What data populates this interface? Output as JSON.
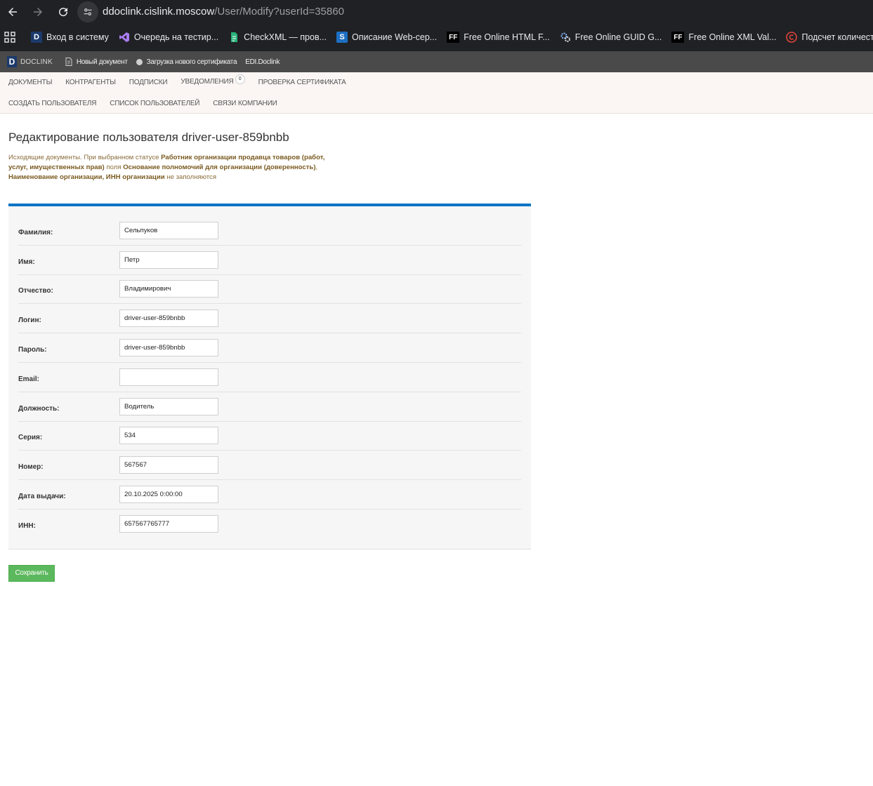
{
  "browser": {
    "url_host": "ddoclink.cislink.moscow",
    "url_path": "/User/Modify?userId=35860",
    "bookmarks": [
      {
        "label": "Вход в систему",
        "icon": "D"
      },
      {
        "label": "Очередь на тестир...",
        "icon": "VS"
      },
      {
        "label": "CheckXML — пров...",
        "icon": "doc"
      },
      {
        "label": "Описание Web-сер...",
        "icon": "S"
      },
      {
        "label": "Free Online HTML F...",
        "icon": "FF"
      },
      {
        "label": "Free Online GUID G...",
        "icon": "gear"
      },
      {
        "label": "Free Online XML Val...",
        "icon": "FF"
      },
      {
        "label": "Подсчет количеств...",
        "icon": "C"
      }
    ]
  },
  "sitebar": {
    "logo_letter": "D",
    "logo_text": "DOCLINK",
    "items": [
      {
        "label": "Новый документ"
      },
      {
        "label": "Загрузка нового сертификата"
      },
      {
        "label": "EDI.Doclink"
      }
    ]
  },
  "menu": {
    "row1": [
      "ДОКУМЕНТЫ",
      "КОНТРАГЕНТЫ",
      "ПОДПИСКИ",
      "УВЕДОМЛЕНИЯ",
      "ПРОВЕРКА СЕРТИФИКАТА"
    ],
    "notifications_count": "0",
    "row2": [
      "СОЗДАТЬ ПОЛЬЗОВАТЕЛЯ",
      "СПИСОК ПОЛЬЗОВАТЕЛЕЙ",
      "СВЯЗИ КОМПАНИИ"
    ]
  },
  "page": {
    "title": "Редактирование пользователя driver-user-859bnbb",
    "notice_1": "Исходящие документы. При выбранном статусе ",
    "notice_2": "Работник организации продавца товаров (работ, услуг, имущественных прав)",
    "notice_3": " поля ",
    "notice_4": "Основание полномочий для организации (доверенность)",
    "notice_5": ", ",
    "notice_6": "Наименование организации, ИНН организации",
    "notice_7": " не заполняются"
  },
  "form": {
    "fields": [
      {
        "label": "Фамилия:",
        "value": "Сельпуков"
      },
      {
        "label": "Имя:",
        "value": "Петр"
      },
      {
        "label": "Отчество:",
        "value": "Владимирович"
      },
      {
        "label": "Логин:",
        "value": "driver-user-859bnbb"
      },
      {
        "label": "Пароль:",
        "value": "driver-user-859bnbb"
      },
      {
        "label": "Email:",
        "value": ""
      },
      {
        "label": "Должность:",
        "value": "Водитель"
      },
      {
        "label": "Серия:",
        "value": "534"
      },
      {
        "label": "Номер:",
        "value": "567567"
      },
      {
        "label": "Дата выдачи:",
        "value": "20.10.2025 0:00:00"
      },
      {
        "label": "ИНН:",
        "value": "657567765777"
      }
    ],
    "save_label": "Сохранить"
  },
  "colors": {
    "accent_border": "#0a74c4",
    "save_button": "#5cb85c",
    "notice_text": "#8a6d3b"
  }
}
